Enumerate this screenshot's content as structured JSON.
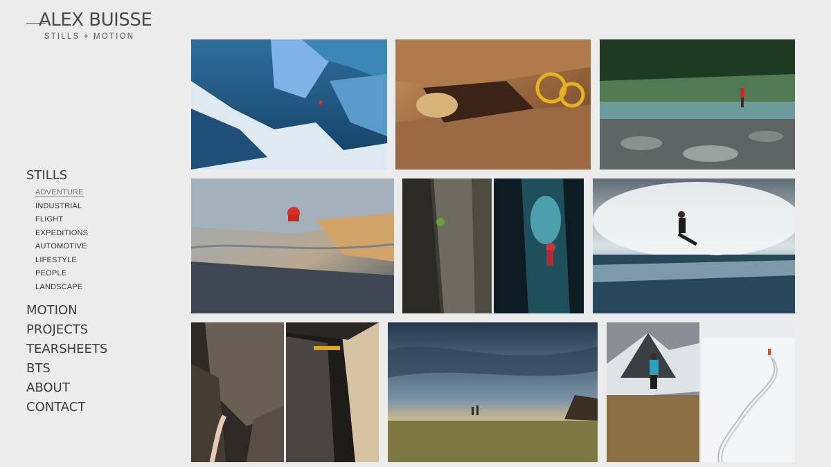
{
  "header": {
    "logo_title": "ALEX BUISSE",
    "logo_subtitle": "STILLS + MOTION"
  },
  "nav": {
    "stills": "STILLS",
    "stills_items": [
      {
        "label": "ADVENTURE",
        "active": true
      },
      {
        "label": "INDUSTRIAL"
      },
      {
        "label": "FLIGHT"
      },
      {
        "label": "EXPEDITIONS"
      },
      {
        "label": "AUTOMOTIVE"
      },
      {
        "label": "LIFESTYLE"
      },
      {
        "label": "PEOPLE"
      },
      {
        "label": "LANDSCAPE"
      }
    ],
    "main_items": [
      {
        "label": "MOTION"
      },
      {
        "label": "PROJECTS"
      },
      {
        "label": "TEARSHEETS"
      },
      {
        "label": "BTS"
      },
      {
        "label": "ABOUT"
      },
      {
        "label": "CONTACT"
      }
    ]
  },
  "gallery": {
    "photos": [
      "ice-cave-climber",
      "crack-climber-with-camming-devices",
      "trail-runner-crossing-river",
      "climber-on-overhanging-rock",
      "climber-on-limestone-wall",
      "ice-climber-in-blue-cave",
      "surfer-on-wave",
      "hand-reaching-rock",
      "hand-in-crack",
      "runners-in-grassland-under-stormy-sky",
      "trail-runner-in-mountains",
      "skier-tracks-in-snow"
    ]
  }
}
